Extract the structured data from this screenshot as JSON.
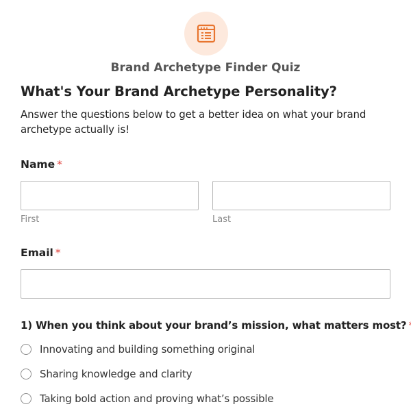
{
  "colors": {
    "accent": "#e8752f",
    "badge_background": "#fde9dd",
    "required": "#e0403a",
    "input_border": "#b8b8b8"
  },
  "header": {
    "icon": "form-icon",
    "form_title": "Brand Archetype Finder Quiz"
  },
  "intro": {
    "heading": "What's Your Brand Archetype Personality?",
    "description": "Answer the questions below to get a better idea on what your brand archetype actually is!"
  },
  "fields": {
    "name": {
      "label": "Name",
      "required_mark": "*",
      "first_sublabel": "First",
      "last_sublabel": "Last",
      "first_value": "",
      "last_value": ""
    },
    "email": {
      "label": "Email",
      "required_mark": "*",
      "value": ""
    }
  },
  "question1": {
    "text": "1) When you think about your brand’s mission, what matters most?",
    "required_mark": "*",
    "options": [
      "Innovating and building something original",
      "Sharing knowledge and clarity",
      "Taking bold action and proving what’s possible"
    ]
  }
}
